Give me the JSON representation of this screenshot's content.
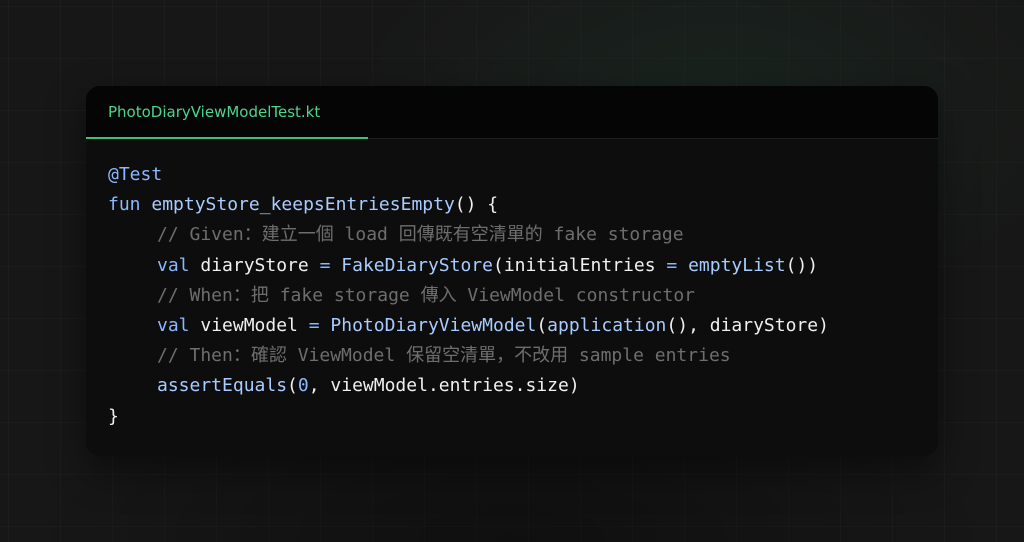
{
  "editor": {
    "tab": {
      "filename": "PhotoDiaryViewModelTest.kt"
    },
    "lines": [
      {
        "tokens": [
          {
            "text": "@Test",
            "type": "annotation"
          }
        ]
      },
      {
        "tokens": [
          {
            "text": "fun ",
            "type": "keyword"
          },
          {
            "text": "emptyStore_keepsEntriesEmpty",
            "type": "function"
          },
          {
            "text": "() {",
            "type": "plain"
          }
        ]
      },
      {
        "indent": 1,
        "tokens": [
          {
            "text": "// Given：建立一個 load 回傳既有空清單的 fake storage",
            "type": "comment"
          }
        ]
      },
      {
        "indent": 1,
        "tokens": [
          {
            "text": "val ",
            "type": "keyword"
          },
          {
            "text": "diaryStore ",
            "type": "plain"
          },
          {
            "text": "= ",
            "type": "operator"
          },
          {
            "text": "FakeDiaryStore",
            "type": "function"
          },
          {
            "text": "(initialEntries ",
            "type": "plain"
          },
          {
            "text": "= ",
            "type": "operator"
          },
          {
            "text": "emptyList",
            "type": "function"
          },
          {
            "text": "())",
            "type": "plain"
          }
        ]
      },
      {
        "indent": 1,
        "tokens": [
          {
            "text": "// When：把 fake storage 傳入 ViewModel constructor",
            "type": "comment"
          }
        ]
      },
      {
        "indent": 1,
        "tokens": [
          {
            "text": "val ",
            "type": "keyword"
          },
          {
            "text": "viewModel ",
            "type": "plain"
          },
          {
            "text": "= ",
            "type": "operator"
          },
          {
            "text": "PhotoDiaryViewModel",
            "type": "function"
          },
          {
            "text": "(",
            "type": "plain"
          },
          {
            "text": "application",
            "type": "function"
          },
          {
            "text": "(), diaryStore)",
            "type": "plain"
          }
        ]
      },
      {
        "indent": 1,
        "tokens": [
          {
            "text": "// Then：確認 ViewModel 保留空清單，不改用 sample entries",
            "type": "comment"
          }
        ]
      },
      {
        "indent": 1,
        "tokens": [
          {
            "text": "assertEquals",
            "type": "function"
          },
          {
            "text": "(",
            "type": "plain"
          },
          {
            "text": "0",
            "type": "number"
          },
          {
            "text": ", viewModel.entries.size)",
            "type": "plain"
          }
        ]
      },
      {
        "tokens": [
          {
            "text": "}",
            "type": "plain"
          }
        ]
      }
    ]
  },
  "colors": {
    "background": "#171717",
    "card": "#0d0d0d",
    "tab_text": "#4fd48e",
    "tab_underline": "#3fbf7a",
    "keyword": "#8ab8ff",
    "function": "#a8ccff",
    "comment": "#6e6e6e",
    "plain": "#f0f0f0"
  }
}
